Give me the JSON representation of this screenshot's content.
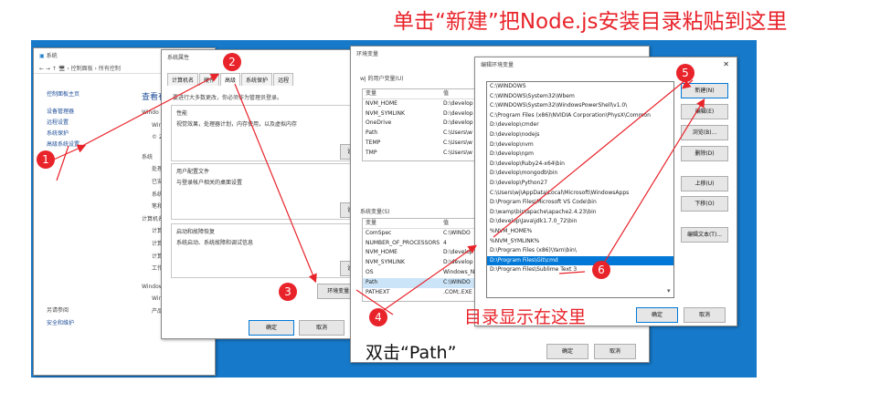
{
  "annotations": {
    "headline": "单击“新建”把Node.js安装目录粘贴到这里",
    "path_caption": "目录显示在这里",
    "double_click_caption": "双击“Path”",
    "steps": [
      "1",
      "2",
      "3",
      "4",
      "5",
      "6"
    ]
  },
  "colors": {
    "desktop": "#1679c9",
    "annotation_red": "#e8232a",
    "selection": "#0078d7"
  },
  "control_panel": {
    "title": "系统",
    "breadcrumb": "← → ↑ 🖥 › 控制面板 › 所有控制",
    "sidebar_links": [
      "控制面板主页",
      "设备管理器",
      "远程设置",
      "系统保护",
      "高级系统设置"
    ],
    "see_also_label": "另请参阅",
    "security_link": "安全和维护",
    "main_heading": "查看有",
    "frag": [
      "Windo",
      "Win",
      "© 2",
      "系统",
      "处理",
      "已安",
      "系统",
      "笔和",
      "计算机名",
      "计算",
      "计算",
      "计算",
      "工作",
      "Window",
      "Win",
      "产品"
    ]
  },
  "sys_props": {
    "title": "系统属性",
    "tabs": [
      "计算机名",
      "硬件",
      "高级",
      "系统保护",
      "远程"
    ],
    "admin_note": "要进行大多数更改，你必须作为管理员登录。",
    "perf_title": "性能",
    "perf_desc": "视觉效果，处理器计划，内存使用，以及虚拟内存",
    "profile_title": "用户配置文件",
    "profile_desc": "与登录帐户相关的桌面设置",
    "startup_title": "启动和故障恢复",
    "startup_desc": "系统启动、系统故障和调试信息",
    "settings_btn": "设置",
    "env_btn": "环境变量...",
    "ok": "确定",
    "cancel": "取消"
  },
  "env_vars": {
    "title": "环境变量",
    "user_group": "wj 的用户变量(U)",
    "col_var": "变量",
    "col_val": "值",
    "user_rows": [
      [
        "NVM_HOME",
        "D:\\develop"
      ],
      [
        "NVM_SYMLINK",
        "D:\\develop"
      ],
      [
        "OneDrive",
        "D:\\develop"
      ],
      [
        "Path",
        "C:\\Users\\w"
      ],
      [
        "TEMP",
        "C:\\Users\\w"
      ],
      [
        "TMP",
        "C:\\Users\\w"
      ]
    ],
    "sys_group": "系统变量(S)",
    "sys_rows": [
      [
        "ComSpec",
        "C:\\WINDO"
      ],
      [
        "NUMBER_OF_PROCESSORS",
        "4"
      ],
      [
        "NVM_HOME",
        "D:\\develop"
      ],
      [
        "NVM_SYMLINK",
        "D:\\develop"
      ],
      [
        "OS",
        "Windows_N"
      ],
      [
        "Path",
        "C:\\WINDO"
      ],
      [
        "PATHEXT",
        ".COM;.EXE"
      ]
    ],
    "ok": "确定",
    "cancel": "取消"
  },
  "edit_env": {
    "title": "编辑环境变量",
    "close": "✕",
    "entries": [
      "C:\\WINDOWS",
      "C:\\WINDOWS\\System32\\Wbem",
      "C:\\WINDOWS\\System32\\WindowsPowerShell\\v1.0\\",
      "C:\\Program Files (x86)\\NVIDIA Corporation\\PhysX\\Common",
      "D:\\develop\\cmder",
      "D:\\develop\\nodejs",
      "D:\\develop\\nvm",
      "D:\\develop\\npm",
      "D:\\develop\\Ruby24-x64\\bin",
      "D:\\develop\\mongodb\\bin",
      "D:\\develop\\Python27",
      "C:\\Users\\wj\\AppData\\Local\\Microsoft\\WindowsApps",
      "D:\\Program Files\\Microsoft VS Code\\bin",
      "D:\\wamp\\bin\\apache\\apache2.4.23\\bin",
      "D:\\develop\\Java\\jdk1.7.0_72\\bin",
      "%NVM_HOME%",
      "%NVM_SYMLINK%",
      "D:\\Program Files (x86)\\Yarn\\bin\\",
      "D:\\Program Files\\Git\\cmd",
      "D:\\Program Files\\Sublime Text 3"
    ],
    "selected_index": 18,
    "buttons": {
      "new": "新建(N)",
      "edit": "编辑(E)",
      "browse": "浏览(B)...",
      "delete": "删除(D)",
      "up": "上移(U)",
      "down": "下移(O)",
      "edit_text": "编辑文本(T)..."
    },
    "ok": "确定",
    "cancel": "取消"
  }
}
